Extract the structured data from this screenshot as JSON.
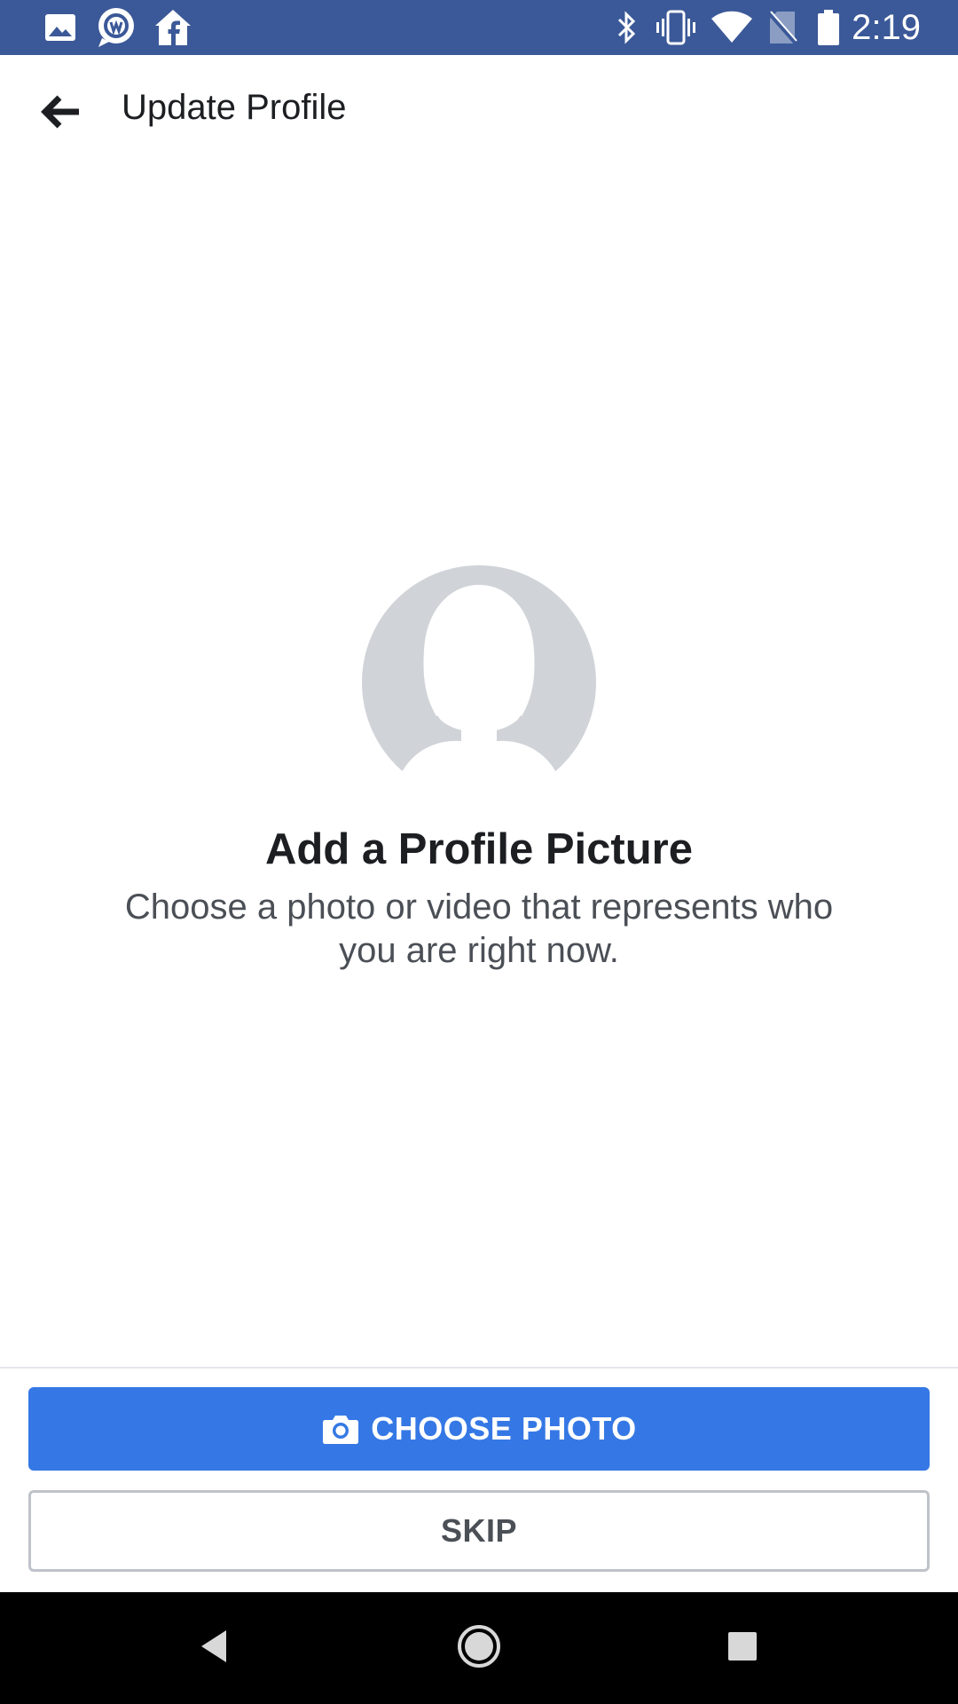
{
  "status_bar": {
    "time": "2:19",
    "left_icons": [
      "gallery-icon",
      "workplace-chat-icon",
      "facebook-home-icon"
    ],
    "right_icons": [
      "bluetooth-icon",
      "vibrate-icon",
      "wifi-icon",
      "no-sim-icon",
      "battery-icon"
    ],
    "background_color": "#3b5998"
  },
  "app_bar": {
    "title": "Update Profile",
    "back_icon": "back-arrow-icon"
  },
  "main": {
    "avatar_icon": "profile-silhouette-icon",
    "heading": "Add a Profile Picture",
    "subtext": "Choose a photo or video that represents who you are right now."
  },
  "actions": {
    "choose_photo_label": "CHOOSE PHOTO",
    "choose_photo_icon": "camera-icon",
    "choose_photo_color": "#3578e5",
    "skip_label": "SKIP"
  },
  "nav_bar": {
    "buttons": [
      "back-triangle-icon",
      "home-circle-icon",
      "recents-square-icon"
    ]
  }
}
